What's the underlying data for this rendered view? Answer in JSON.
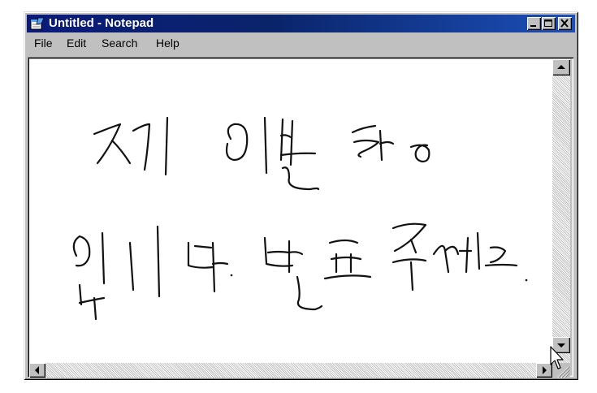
{
  "window": {
    "title": "Untitled - Notepad",
    "icon": "notepad-icon"
  },
  "title_buttons": [
    "minimize-icon",
    "maximize-icon",
    "close-icon"
  ],
  "menu": {
    "items": [
      {
        "label": "File"
      },
      {
        "label": "Edit"
      },
      {
        "label": "Search"
      },
      {
        "label": "Help"
      }
    ]
  },
  "editor": {
    "content_note": "handwritten Korean strokes (two lines)",
    "ink_color": "#111111"
  },
  "scrollbars": [
    "vertical-scrollbar",
    "horizontal-scrollbar"
  ],
  "colors": {
    "titlebar_start": "#0a1a7a",
    "titlebar_end": "#1c4fb8",
    "chrome": "#c0c0c0",
    "text_bg": "#ffffff"
  }
}
